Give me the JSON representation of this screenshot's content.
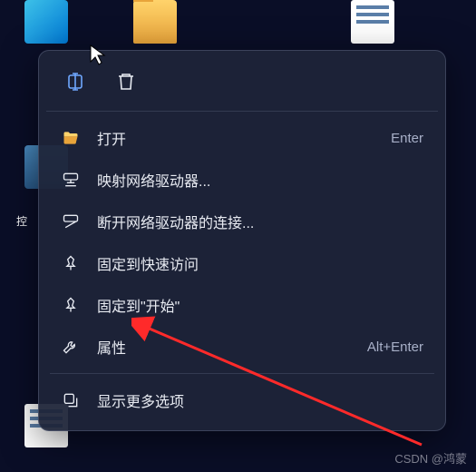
{
  "desktop": {
    "label_frag": "控"
  },
  "context_menu": {
    "items": [
      {
        "label": "打开",
        "shortcut": "Enter"
      },
      {
        "label": "映射网络驱动器...",
        "shortcut": ""
      },
      {
        "label": "断开网络驱动器的连接...",
        "shortcut": ""
      },
      {
        "label": "固定到快速访问",
        "shortcut": ""
      },
      {
        "label": "固定到\"开始\"",
        "shortcut": ""
      },
      {
        "label": "属性",
        "shortcut": "Alt+Enter"
      },
      {
        "label": "显示更多选项",
        "shortcut": ""
      }
    ]
  },
  "watermark": "CSDN @鸿蒙"
}
